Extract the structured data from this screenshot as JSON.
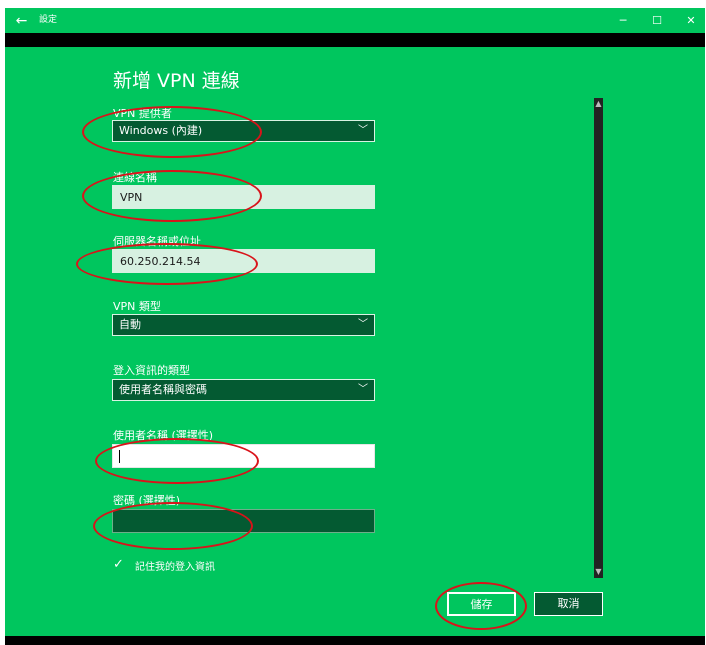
{
  "window": {
    "title": "設定",
    "back_icon": "←",
    "minimize_icon": "─",
    "maximize_icon": "☐",
    "close_icon": "✕"
  },
  "form": {
    "heading": "新增 VPN 連線",
    "provider_label": "VPN 提供者",
    "provider_value": "Windows (內建)",
    "connection_name_label": "連線名稱",
    "connection_name_value": "VPN",
    "server_label": "伺服器名稱或位址",
    "server_value": "60.250.214.54",
    "vpn_type_label": "VPN 類型",
    "vpn_type_value": "自動",
    "signin_type_label": "登入資訊的類型",
    "signin_type_value": "使用者名稱與密碼",
    "username_label": "使用者名稱 (選擇性)",
    "username_value": "",
    "password_label": "密碼 (選擇性)",
    "password_value": "",
    "remember_label": "記住我的登入資訊",
    "remember_checked": true,
    "dropdown_chevron": "﹀"
  },
  "buttons": {
    "save": "儲存",
    "cancel": "取消"
  },
  "colors": {
    "accent": "#00c65e",
    "field_dark": "#045a32",
    "field_light": "#d7f1e1",
    "annotation": "#d9131a"
  }
}
